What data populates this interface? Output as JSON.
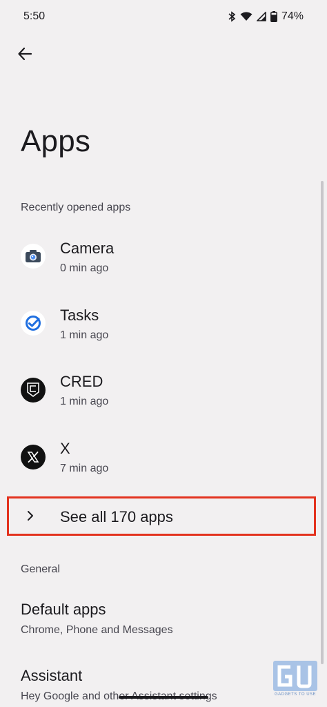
{
  "status_bar": {
    "time": "5:50",
    "battery": "74%",
    "icons": [
      "bluetooth-icon",
      "wifi-icon",
      "signal-icon",
      "battery-icon"
    ]
  },
  "header": {
    "back_icon": "arrow-left-icon",
    "title": "Apps"
  },
  "recent": {
    "section_label": "Recently opened apps",
    "items": [
      {
        "name": "Camera",
        "time": "0 min ago",
        "icon": "camera-icon"
      },
      {
        "name": "Tasks",
        "time": "1 min ago",
        "icon": "tasks-icon"
      },
      {
        "name": "CRED",
        "time": "1 min ago",
        "icon": "cred-icon"
      },
      {
        "name": "X",
        "time": "7 min ago",
        "icon": "x-icon"
      }
    ]
  },
  "see_all": {
    "label": "See all 170 apps",
    "icon": "chevron-right-icon",
    "highlight_color": "#e3321e"
  },
  "general": {
    "section_label": "General",
    "items": [
      {
        "title": "Default apps",
        "subtitle": "Chrome, Phone and Messages"
      },
      {
        "title": "Assistant",
        "subtitle": "Hey Google and other Assistant settings"
      }
    ]
  },
  "watermark": {
    "text": "GADGETS TO USE"
  },
  "colors": {
    "background": "#f2f0f1",
    "text": "#1c1b1f",
    "secondary_text": "#47464f"
  }
}
